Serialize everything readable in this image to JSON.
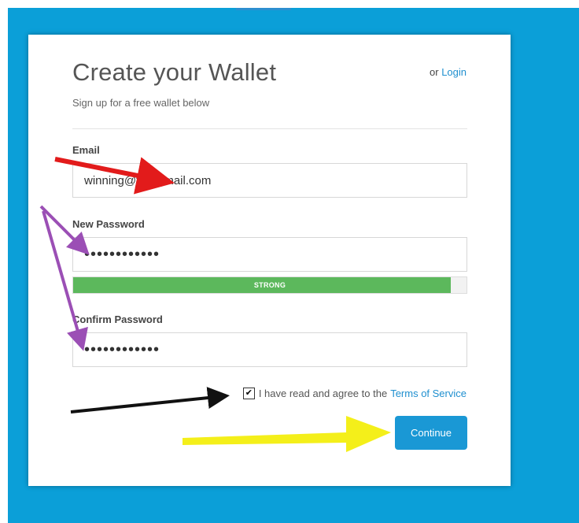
{
  "header": {
    "title": "Create your Wallet",
    "login_prefix": "or",
    "login_label": "Login",
    "subtitle": "Sign up for a free wallet below"
  },
  "form": {
    "email_label": "Email",
    "email_value": "winning@ts@gmail.com",
    "password_label": "New Password",
    "password_value": "••••••••••••",
    "strength_label": "STRONG",
    "strength_fraction": 0.96,
    "confirm_label": "Confirm Password",
    "confirm_value": "••••••••••••",
    "terms_checked": true,
    "terms_text": "I have read and agree to the",
    "terms_link": "Terms of Service",
    "continue_label": "Continue"
  },
  "colors": {
    "background": "#0b9fd8",
    "accent": "#1a98d5",
    "strength": "#5cb85c",
    "arrow_red": "#e21b1b",
    "arrow_purple": "#9b4fb5",
    "arrow_black": "#111111",
    "arrow_yellow": "#f4ef1a"
  }
}
